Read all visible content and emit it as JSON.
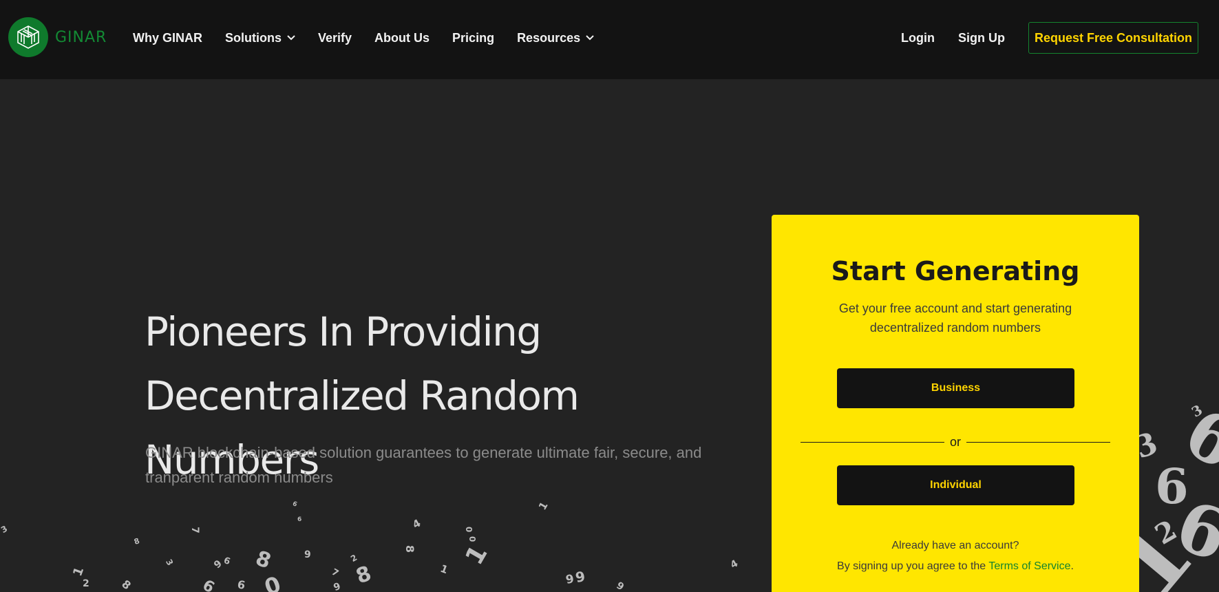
{
  "brand": {
    "name": "GINAR"
  },
  "nav": {
    "items": [
      {
        "label": "Why GINAR",
        "dropdown": false
      },
      {
        "label": "Solutions",
        "dropdown": true
      },
      {
        "label": "Verify",
        "dropdown": false
      },
      {
        "label": "About Us",
        "dropdown": false
      },
      {
        "label": "Pricing",
        "dropdown": false
      },
      {
        "label": "Resources",
        "dropdown": true
      }
    ],
    "login": "Login",
    "signup": "Sign Up",
    "cta": "Request Free Consultation"
  },
  "hero": {
    "title_line1": "Pioneers In Providing",
    "title_line2": "Decentralized Random Numbers",
    "subtitle": "GINAR blockchain-based solution guarantees to generate ultimate fair, secure, and tranparent random numbers"
  },
  "signup_card": {
    "title": "Start Generating",
    "subtitle": "Get your free account and start generating decentralized random numbers",
    "business_button": "Business",
    "or": "or",
    "individual_button": "Individual",
    "already": "Already have an account?",
    "terms_prefix": "By signing up you agree to the ",
    "terms_link": "Terms of Service",
    "terms_suffix": "."
  },
  "colors": {
    "brand_green": "#0f7a2c",
    "accent_yellow": "#ffe600",
    "cta_text": "#ffd400",
    "background": "#232323",
    "header": "#131313"
  }
}
